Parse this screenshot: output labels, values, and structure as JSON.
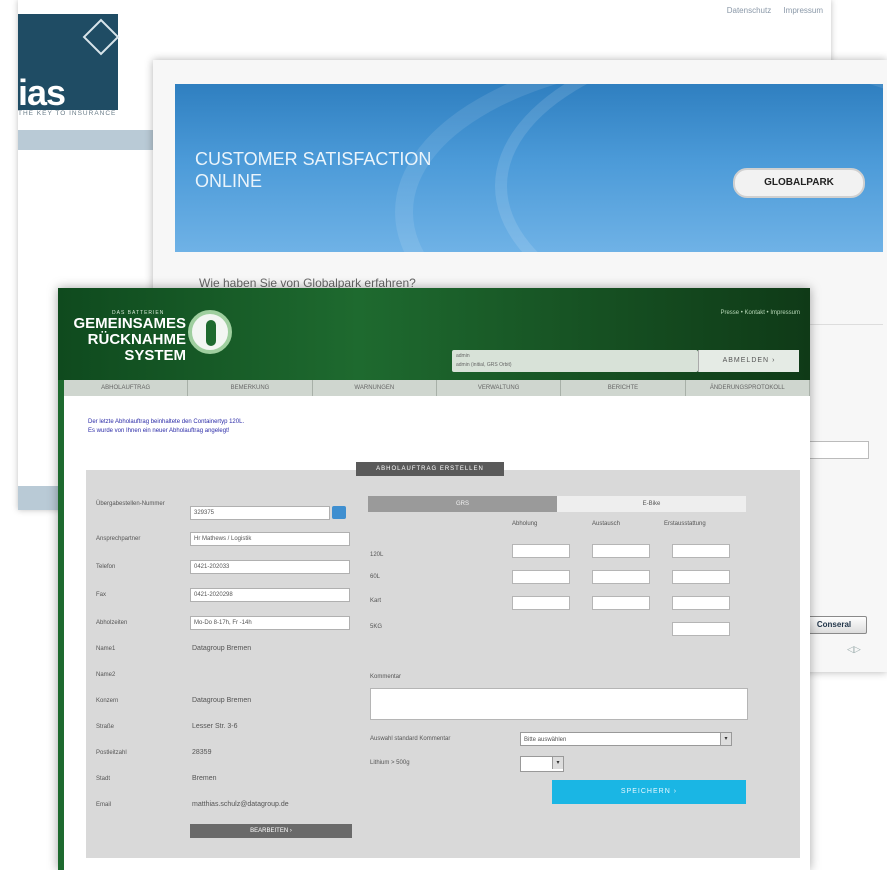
{
  "back_window": {
    "links": [
      "Datenschutz",
      "Impressum"
    ],
    "logo_text": "ias",
    "tagline": "THE KEY TO INSURANCE"
  },
  "middle_window": {
    "title_line1": "CUSTOMER SATISFACTION",
    "title_line2": "ONLINE",
    "brand": "GLOBALPARK",
    "question": "Wie haben Sie von Globalpark erfahren?",
    "button_label": "Conseral"
  },
  "grs": {
    "small_label": "DAS BATTERIEN",
    "name_line1": "GEMEINSAMES",
    "name_line2": "RÜCKNAHME",
    "name_line3": "SYSTEM",
    "top_links": "Presse  •  Kontakt  •  Impressum",
    "login_line1": "admin",
    "login_line2": "admin (initial, GRS Orbit)",
    "logout_label": "ABMELDEN",
    "nav": [
      "ABHOLAUFTRAG",
      "BEMERKUNG",
      "WARNUNGEN",
      "VERWALTUNG",
      "BERICHTE",
      "ÄNDERUNGSPROTOKOLL"
    ],
    "message_line1": "Der letzte Abholauftrag beinhaltete den Containertyp 120L.",
    "message_line2": "Es wurde von Ihnen ein neuer Abholauftrag angelegt!",
    "panel_title": "ABHOLAUFTRAG ERSTELLEN",
    "fields": [
      {
        "label": "Übergabestellen-Nummer",
        "value": "329375"
      },
      {
        "label": "Ansprechpartner",
        "value": "Hr Mathews / Logistik"
      },
      {
        "label": "Telefon",
        "value": "0421-202033"
      },
      {
        "label": "Fax",
        "value": "0421-2020298"
      },
      {
        "label": "Abholzeiten",
        "value": "Mo-Do 8-17h, Fr -14h"
      }
    ],
    "static_fields": [
      {
        "label": "Name1",
        "value": "Datagroup Bremen"
      },
      {
        "label": "Name2",
        "value": ""
      },
      {
        "label": "Konzern",
        "value": "Datagroup Bremen"
      },
      {
        "label": "Straße",
        "value": "Lesser Str. 3-6"
      },
      {
        "label": "Postleitzahl",
        "value": "28359"
      },
      {
        "label": "Stadt",
        "value": "Bremen"
      },
      {
        "label": "Email",
        "value": "matthias.schulz@datagroup.de"
      }
    ],
    "edit_label": "BEARBEITEN",
    "tab_grs": "GRS",
    "tab_ebike": "E-Bike",
    "col_heads": [
      "Abholung",
      "Austausch",
      "Erstausstattung"
    ],
    "rows": [
      "120L",
      "60L",
      "Kart",
      "5KG"
    ],
    "kommentar_label": "Kommentar",
    "std_kommentar_label": "Auswahl standard Kommentar",
    "std_kommentar_value": "Bitte auswählen",
    "lithium_label": "Lithium > 500g",
    "save_label": "SPEICHERN"
  }
}
